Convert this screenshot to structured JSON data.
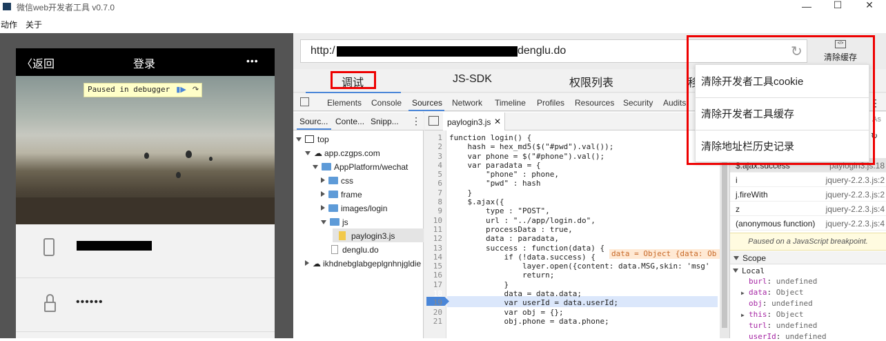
{
  "window": {
    "title": "微信web开发者工具 v0.7.0",
    "min": "—",
    "max": "☐",
    "close": "✕"
  },
  "menu": [
    "动作",
    "关于"
  ],
  "phone": {
    "back": "返回",
    "title": "登录",
    "more": "•••",
    "paused": "Paused in debugger",
    "password": "••••••"
  },
  "url": {
    "prefix": "http:/",
    "suffix": "denglu.do",
    "clear_label": "清除缓存"
  },
  "top_tabs": [
    "调试",
    "JS-SDK",
    "权限列表",
    "移"
  ],
  "devtools_tabs": [
    "Elements",
    "Console",
    "Sources",
    "Network",
    "Timeline",
    "Profiles",
    "Resources",
    "Security",
    "Audits"
  ],
  "nav_tabs": [
    "Sourc...",
    "Conte...",
    "Snipp..."
  ],
  "file_tab": "paylogin3.js",
  "tree": {
    "top": "top",
    "domain": "app.czgps.com",
    "app_folder": "AppPlatform/wechat",
    "css": "css",
    "frame": "frame",
    "images": "images/login",
    "js": "js",
    "file": "paylogin3.js",
    "denglu": "denglu.do",
    "ext": "ikhdnebglabgeplgnhnjgldie"
  },
  "code": [
    {
      "n": "1",
      "t": "function login() {"
    },
    {
      "n": "2",
      "t": "    hash = hex_md5($(\"#pwd\").val());"
    },
    {
      "n": "3",
      "t": "    var phone = $(\"#phone\").val();"
    },
    {
      "n": "4",
      "t": "    var paradata = {"
    },
    {
      "n": "5",
      "t": "        \"phone\" : phone,"
    },
    {
      "n": "6",
      "t": "        \"pwd\" : hash"
    },
    {
      "n": "7",
      "t": "    }"
    },
    {
      "n": "8",
      "t": "    $.ajax({"
    },
    {
      "n": "9",
      "t": "        type : \"POST\","
    },
    {
      "n": "10",
      "t": "        url : \"../app/login.do\","
    },
    {
      "n": "11",
      "t": "        processData : true,"
    },
    {
      "n": "12",
      "t": "        data : paradata,"
    },
    {
      "n": "13",
      "t": "        success : function(data) {"
    },
    {
      "n": "14",
      "t": "            if (!data.success) {"
    },
    {
      "n": "15",
      "t": "                layer.open({content: data.MSG,skin: 'msg'"
    },
    {
      "n": "16",
      "t": "                return;"
    },
    {
      "n": "17",
      "t": "            }"
    },
    {
      "n": "18",
      "t": "            data = data.data;"
    },
    {
      "n": "19",
      "t": "            var userId = data.userId;"
    },
    {
      "n": "20",
      "t": "            var obj = {};"
    },
    {
      "n": "21",
      "t": "            obj.phone = data.phone;"
    }
  ],
  "inline_value": "data = Object {data: Ob",
  "call_stack": [
    {
      "fn": "$.ajax.success",
      "loc": "paylogin3.js:18"
    },
    {
      "fn": "i",
      "loc": "jquery-2.2.3.js:2"
    },
    {
      "fn": "j.fireWith",
      "loc": "jquery-2.2.3.js:2"
    },
    {
      "fn": "z",
      "loc": "jquery-2.2.3.js:4"
    },
    {
      "fn": "(anonymous function)",
      "loc": "jquery-2.2.3.js:4"
    }
  ],
  "paused_note": "Paused on a JavaScript breakpoint.",
  "scope": {
    "header": "Scope",
    "local": "Local",
    "vars": [
      {
        "k": "burl",
        "v": "undefined",
        "exp": false
      },
      {
        "k": "data",
        "v": "Object",
        "exp": true
      },
      {
        "k": "obj",
        "v": "undefined",
        "exp": false
      },
      {
        "k": "this",
        "v": "Object",
        "exp": true
      },
      {
        "k": "turl",
        "v": "undefined",
        "exp": false
      },
      {
        "k": "userId",
        "v": "undefined",
        "exp": false
      }
    ]
  },
  "dropdown": [
    "清除开发者工具cookie",
    "清除开发者工具缓存",
    "清除地址栏历史记录"
  ],
  "as_label": "As"
}
